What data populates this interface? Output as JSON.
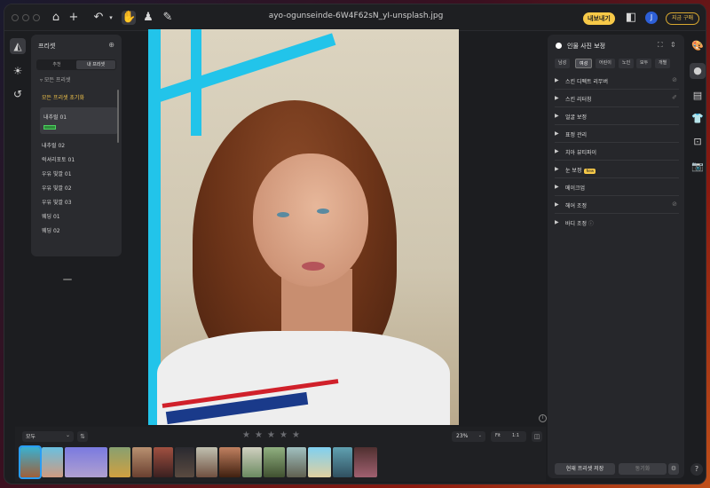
{
  "window": {
    "filename": "ayo-ogunseinde-6W4F62sN_yI-unsplash.jpg"
  },
  "topbar": {
    "home_icon": "home-icon",
    "export_label": "내보내기",
    "avatar_initial": "J",
    "buy_label": "지금 구매"
  },
  "presets": {
    "title": "프리셋",
    "tabs": [
      "추천",
      "내 프리셋"
    ],
    "filter_label": "모든 프리셋",
    "reset_label": "모든 프리셋 초기화",
    "items": [
      "내추럴 01",
      "내추럴 02",
      "럭셔리포토 01",
      "우유 빛깔 01",
      "우유 빛깔 02",
      "우유 빛깔 03",
      "웨딩 01",
      "웨딩 02"
    ],
    "selected_index": 0
  },
  "portrait": {
    "title": "인물 사진 보정",
    "gender_tabs": [
      "남성",
      "여성",
      "어린이",
      "노인",
      "모두",
      "개별"
    ],
    "active_tab": 1,
    "sections": [
      {
        "label": "스킨 디펙트 리무버",
        "badge": ""
      },
      {
        "label": "스킨 리터칭",
        "badge": ""
      },
      {
        "label": "얼굴 보정",
        "badge": ""
      },
      {
        "label": "표정 관리",
        "badge": ""
      },
      {
        "label": "치아 뷰티파이",
        "badge": ""
      },
      {
        "label": "눈 보정",
        "badge": "New"
      },
      {
        "label": "메이크업",
        "badge": ""
      },
      {
        "label": "헤어 조정",
        "badge": ""
      },
      {
        "label": "바디 조정",
        "badge": ""
      }
    ],
    "save_preset_label": "현재 프리셋 저장",
    "sync_label": "동기화"
  },
  "bottom": {
    "filter_value": "모두",
    "zoom_value": "23%",
    "fit_label": "Fit",
    "one_label": "1:1",
    "rating_stars": 5
  },
  "colors": {
    "accent": "#f7c948",
    "selection": "#2a9df4",
    "teal_frame": "#22c4ea"
  }
}
